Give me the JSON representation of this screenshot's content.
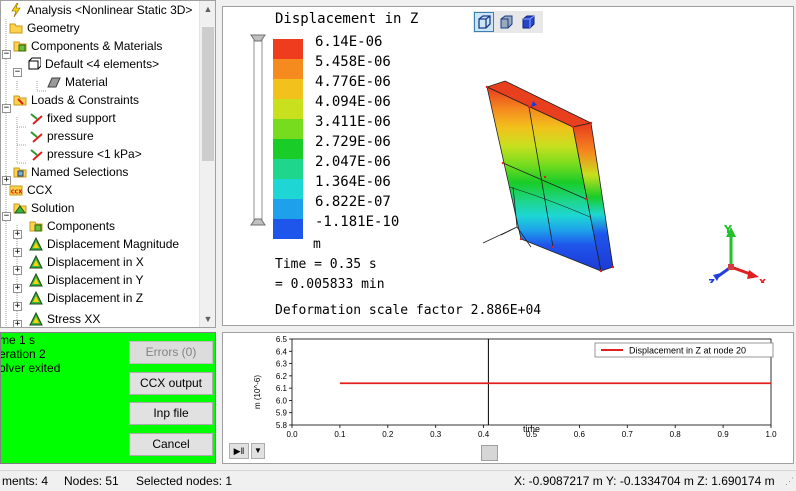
{
  "tree": {
    "items": [
      {
        "label": "Analysis <Nonlinear Static 3D>",
        "icon": "analysis-bolt-icon"
      },
      {
        "label": "Geometry",
        "icon": "folder-icon"
      },
      {
        "label": "Components & Materials",
        "icon": "components-icon"
      },
      {
        "label": "Default <4 elements>",
        "icon": "element-group-icon"
      },
      {
        "label": "Material",
        "icon": "material-icon"
      },
      {
        "label": "Loads & Constraints",
        "icon": "loads-folder-icon"
      },
      {
        "label": "fixed support",
        "icon": "support-icon"
      },
      {
        "label": "pressure",
        "icon": "pressure-icon"
      },
      {
        "label": "pressure <1 kPa>",
        "icon": "pressure-icon"
      },
      {
        "label": "Named Selections",
        "icon": "named-selections-icon"
      },
      {
        "label": "CCX",
        "icon": "ccx-icon"
      },
      {
        "label": "Solution",
        "icon": "solution-icon"
      },
      {
        "label": "Components",
        "icon": "components-icon"
      },
      {
        "label": "Displacement Magnitude",
        "icon": "result-icon"
      },
      {
        "label": "Displacement in X",
        "icon": "result-icon"
      },
      {
        "label": "Displacement in Y",
        "icon": "result-icon"
      },
      {
        "label": "Displacement in Z",
        "icon": "result-icon"
      },
      {
        "label": "Stress XX",
        "icon": "result-icon"
      }
    ]
  },
  "view": {
    "legend_title": "Displacement in Z",
    "legend_values": [
      "6.14E-06",
      "5.458E-06",
      "4.776E-06",
      "4.094E-06",
      "3.411E-06",
      "2.729E-06",
      "2.047E-06",
      "1.364E-06",
      "6.822E-07",
      "-1.181E-10"
    ],
    "legend_colors": [
      "#f03c1e",
      "#f58a1e",
      "#f2c11c",
      "#c8e01e",
      "#78dc1e",
      "#19cc28",
      "#1ed68c",
      "#1ed6d4",
      "#1ea0eb",
      "#1e55eb"
    ],
    "unit": "m",
    "time_line": "Time = 0.35 s",
    "time_min_line": "= 0.005833 min",
    "deformation": "Deformation scale factor 2.886E+04",
    "axes": {
      "x": "x",
      "y": "Y",
      "z": "Z"
    }
  },
  "status_panel": {
    "lines": [
      "me 1 s",
      "eration 2",
      "olver exited"
    ],
    "bg": "#00ff00"
  },
  "buttons": {
    "errors": "Errors (0)",
    "ccx_output": "CCX output",
    "inp_file": "Inp file",
    "cancel": "Cancel"
  },
  "chart_data": {
    "type": "line",
    "title": "",
    "xlabel": "time",
    "ylabel": "m (10^-6)",
    "xlim": [
      0.0,
      1.0
    ],
    "ylim": [
      5.8,
      6.5
    ],
    "xticks": [
      "0.0",
      "0.1",
      "0.2",
      "0.3",
      "0.4",
      "0.5",
      "0.6",
      "0.7",
      "0.8",
      "0.9",
      "1.0"
    ],
    "yticks": [
      "5.8",
      "5.9",
      "6.0",
      "6.1",
      "6.2",
      "6.3",
      "6.4",
      "6.5"
    ],
    "series": [
      {
        "name": "Displacement in Z at node 20",
        "color": "#e0201e",
        "x": [
          0.1,
          1.0
        ],
        "y": [
          6.14,
          6.14
        ]
      }
    ],
    "cursor_x": 0.41,
    "legend": "top-right",
    "grid": false
  },
  "statusbar": {
    "elements": "ments: 4",
    "nodes": "Nodes: 51",
    "selected": "Selected nodes: 1",
    "coords": "X: -0.9087217 m Y: -0.1334704 m Z: 1.690174 m"
  }
}
